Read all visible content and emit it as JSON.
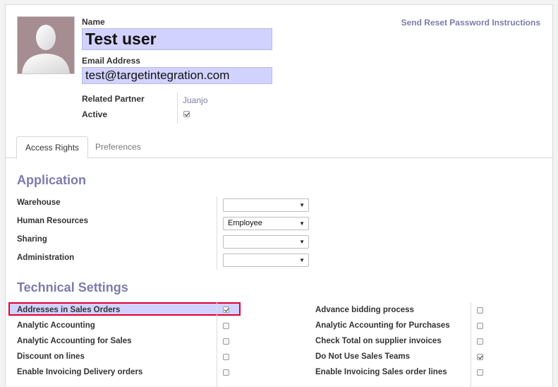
{
  "header": {
    "name_label": "Name",
    "name_value": "Test user",
    "email_label": "Email Address",
    "email_value": "test@targetintegration.com",
    "reset_link": "Send Reset Password Instructions",
    "related_partner_label": "Related Partner",
    "related_partner_value": "Juanjo",
    "active_label": "Active",
    "active_checked": true
  },
  "tabs": [
    {
      "label": "Access Rights",
      "active": true
    },
    {
      "label": "Preferences",
      "active": false
    }
  ],
  "application": {
    "title": "Application",
    "rows": [
      {
        "label": "Warehouse",
        "value": ""
      },
      {
        "label": "Human Resources",
        "value": "Employee"
      },
      {
        "label": "Sharing",
        "value": ""
      },
      {
        "label": "Administration",
        "value": ""
      }
    ]
  },
  "technical": {
    "title": "Technical Settings",
    "left": [
      {
        "label": "Addresses in Sales Orders",
        "checked": true
      },
      {
        "label": "Analytic Accounting",
        "checked": false
      },
      {
        "label": "Analytic Accounting for Sales",
        "checked": false
      },
      {
        "label": "Discount on lines",
        "checked": false
      },
      {
        "label": "Enable Invoicing Delivery orders",
        "checked": false
      }
    ],
    "right": [
      {
        "label": "Advance bidding process",
        "checked": false
      },
      {
        "label": "Analytic Accounting for Purchases",
        "checked": false
      },
      {
        "label": "Check Total on supplier invoices",
        "checked": false
      },
      {
        "label": "Do Not Use Sales Teams",
        "checked": true
      },
      {
        "label": "Enable Invoicing Sales order lines",
        "checked": false
      }
    ]
  },
  "colors": {
    "accent": "#7c7bad",
    "field_bg": "#d2d2ff",
    "highlight_border": "#e00030"
  }
}
